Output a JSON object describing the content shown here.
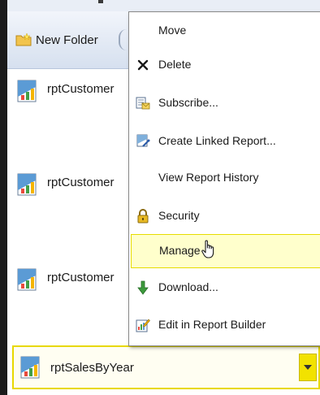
{
  "toolbar": {
    "new_folder_label": "New Folder"
  },
  "list": {
    "items": [
      {
        "name": "rptCustomer"
      },
      {
        "name": "rptCustomer"
      },
      {
        "name": "rptCustomer"
      }
    ],
    "selected": {
      "name": "rptSalesByYear"
    }
  },
  "context_menu": {
    "items": [
      {
        "label": "Move",
        "icon": "none"
      },
      {
        "label": "Delete",
        "icon": "delete-x-icon"
      },
      {
        "label": "Subscribe...",
        "icon": "subscribe-icon"
      },
      {
        "label": "Create Linked Report...",
        "icon": "linked-report-icon"
      },
      {
        "label": "View Report History",
        "icon": "none"
      },
      {
        "label": "Security",
        "icon": "lock-icon"
      },
      {
        "label": "Manage",
        "icon": "none",
        "highlighted": true
      },
      {
        "label": "Download...",
        "icon": "download-arrow-icon"
      },
      {
        "label": "Edit in Report Builder",
        "icon": "report-builder-icon"
      }
    ]
  },
  "colors": {
    "highlight": "#ffffcc",
    "highlight_border": "#e6dc00",
    "dropdown": "#f2e200"
  }
}
